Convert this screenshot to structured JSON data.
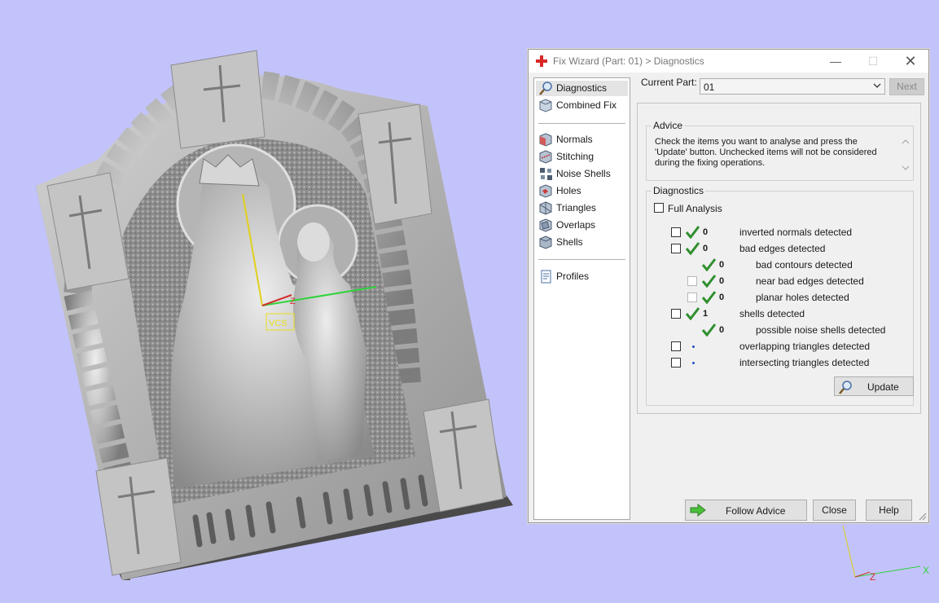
{
  "viewport": {
    "vcs_label": "VCS",
    "axis_z": "Z"
  },
  "wcs": {
    "axis_z": "Z",
    "axis_x": "X"
  },
  "dialog": {
    "title": "Fix Wizard (Part: 01) > Diagnostics",
    "window_controls": {
      "minimize": "—",
      "maximize": "☐",
      "close": "✕"
    },
    "nav": {
      "items": [
        {
          "label": "Diagnostics",
          "icon": "magnifier-icon",
          "selected": true
        },
        {
          "label": "Combined Fix",
          "icon": "cube-icon"
        },
        {
          "label": "Normals",
          "icon": "normals-cube-icon"
        },
        {
          "label": "Stitching",
          "icon": "stitching-cube-icon"
        },
        {
          "label": "Noise Shells",
          "icon": "noise-shells-icon"
        },
        {
          "label": "Holes",
          "icon": "holes-cube-icon"
        },
        {
          "label": "Triangles",
          "icon": "triangles-cube-icon"
        },
        {
          "label": "Overlaps",
          "icon": "overlaps-cube-icon"
        },
        {
          "label": "Shells",
          "icon": "shells-cube-icon"
        },
        {
          "label": "Profiles",
          "icon": "document-icon"
        }
      ]
    },
    "current_part": {
      "label": "Current Part:",
      "value": "01"
    },
    "next_label": "Next",
    "advice": {
      "legend": "Advice",
      "text": "Check the items you want to analyse and press the 'Update' button. Unchecked items will not be considered during the fixing operations."
    },
    "diagnostics": {
      "legend": "Diagnostics",
      "full_analysis": "Full Analysis",
      "rows": [
        {
          "count": "0",
          "label": "inverted normals detected",
          "status": "ok"
        },
        {
          "count": "0",
          "label": "bad edges detected",
          "status": "ok"
        },
        {
          "count": "0",
          "label": "bad contours detected",
          "status": "ok"
        },
        {
          "count": "0",
          "label": "near bad edges detected",
          "status": "ok"
        },
        {
          "count": "0",
          "label": "planar holes detected",
          "status": "ok"
        },
        {
          "count": "1",
          "label": "shells detected",
          "status": "ok"
        },
        {
          "count": "0",
          "label": "possible noise shells detected",
          "status": "ok"
        },
        {
          "count": "",
          "label": "overlapping triangles detected",
          "status": "pending"
        },
        {
          "count": "",
          "label": "intersecting triangles detected",
          "status": "pending"
        }
      ],
      "update_label": "Update"
    },
    "buttons": {
      "follow_advice": "Follow Advice",
      "close": "Close",
      "help": "Help"
    },
    "colors": {
      "accent_red": "#d92727",
      "check_green": "#2f8f2f",
      "pending_blue": "#1d4fbe"
    }
  }
}
